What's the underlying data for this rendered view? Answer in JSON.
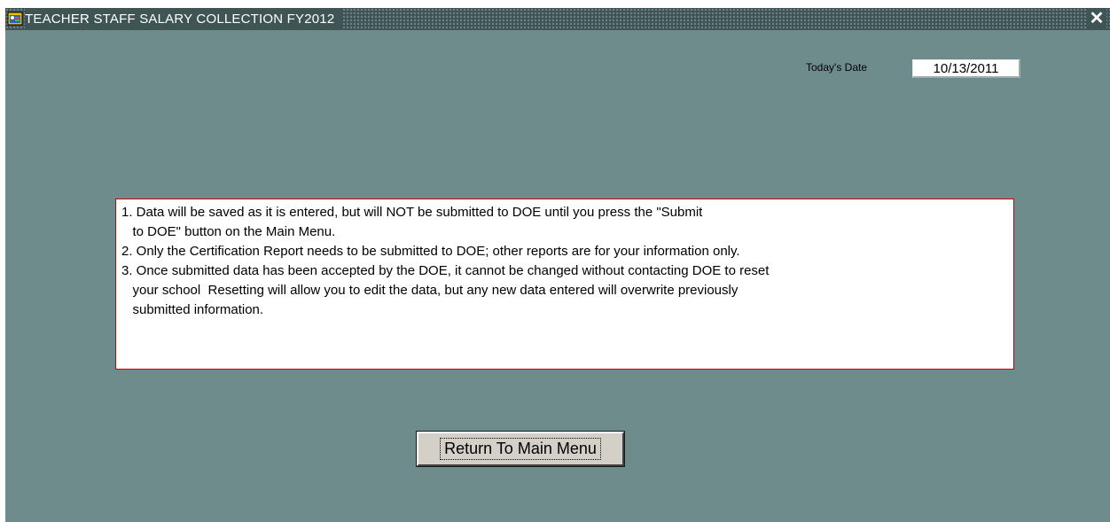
{
  "window": {
    "title": "TEACHER STAFF SALARY COLLECTION FY2012",
    "close_glyph": "✕",
    "app_icon": "oracle-forms-app-icon"
  },
  "date": {
    "label": "Today's Date",
    "value": "10/13/2011"
  },
  "notice": {
    "lines": [
      "1. Data will be saved as it is entered, but will NOT be submitted to DOE until you press the \"Submit",
      "   to DOE\" button on the Main Menu.",
      "2. Only the Certification Report needs to be submitted to DOE; other reports are for your information only.",
      "3. Once submitted data has been accepted by the DOE, it cannot be changed without contacting DOE to reset",
      "   your school  Resetting will allow you to edit the data, but any new data entered will overwrite previously",
      "   submitted information."
    ]
  },
  "buttons": {
    "return_label": "Return To Main Menu"
  },
  "colors": {
    "background": "#6f8c8c",
    "titlebar": "#3f5455",
    "notice_border": "#cc0000"
  }
}
